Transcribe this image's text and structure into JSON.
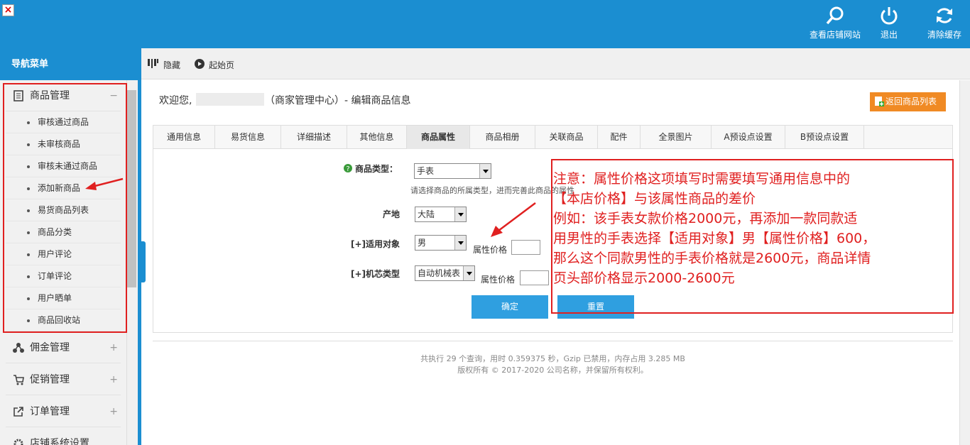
{
  "header": {
    "view_store": "查看店铺网站",
    "logout": "退出",
    "clear_cache": "清除缓存"
  },
  "sidebar": {
    "title": "导航菜单",
    "groups": [
      {
        "label": "商品管理",
        "toggle": "−"
      },
      {
        "label": "佣金管理",
        "toggle": "+"
      },
      {
        "label": "促销管理",
        "toggle": "+"
      },
      {
        "label": "订单管理",
        "toggle": "+"
      },
      {
        "label": "店铺系统设置",
        "toggle": "+"
      }
    ],
    "items": [
      "审核通过商品",
      "未审核商品",
      "审核未通过商品",
      "添加新商品",
      "易货商品列表",
      "商品分类",
      "用户评论",
      "订单评论",
      "用户晒单",
      "商品回收站"
    ]
  },
  "crumb": {
    "hide": "隐藏",
    "home": "起始页"
  },
  "page": {
    "welcome": "欢迎您,",
    "center": "（商家管理中心）- 编辑商品信息",
    "back_button": "返回商品列表"
  },
  "tabs": [
    "通用信息",
    "易货信息",
    "详细描述",
    "其他信息",
    "商品属性",
    "商品相册",
    "关联商品",
    "配件",
    "全景图片",
    "A预设点设置",
    "B预设点设置"
  ],
  "form": {
    "type_label": "商品类型：",
    "type_value": "手表",
    "type_hint": "请选择商品的所属类型，进而完善此商品的属性",
    "origin_label": "产地",
    "origin_value": "大陆",
    "target_label": "[+]适用对象",
    "target_value": "男",
    "price_label": "属性价格",
    "movement_label": "[+]机芯类型",
    "movement_value": "自动机械表",
    "confirm": "确定",
    "reset": "重置"
  },
  "note": {
    "lines": [
      "注意：属性价格这项填写时需要填写通用信息中的",
      "【本店价格】与该属性商品的差价",
      "例如：该手表女款价格2000元，再添加一款同款适",
      "用男性的手表选择【适用对象】男【属性价格】600，",
      "那么这个同款男性的手表价格就是2600元，商品详情",
      "页头部价格显示2000-2600元"
    ]
  },
  "footer": {
    "stats": "共执行  29 个查询，用时  0.359375 秒，Gzip 已禁用，内存占用  3.285 MB",
    "copyright": "版权所有 © 2017-2020 公司名称，并保留所有权利。"
  },
  "colors": {
    "brand": "#1b8ed1",
    "orange": "#f08a24",
    "annotation": "#e02020",
    "button": "#2f9fe0"
  }
}
